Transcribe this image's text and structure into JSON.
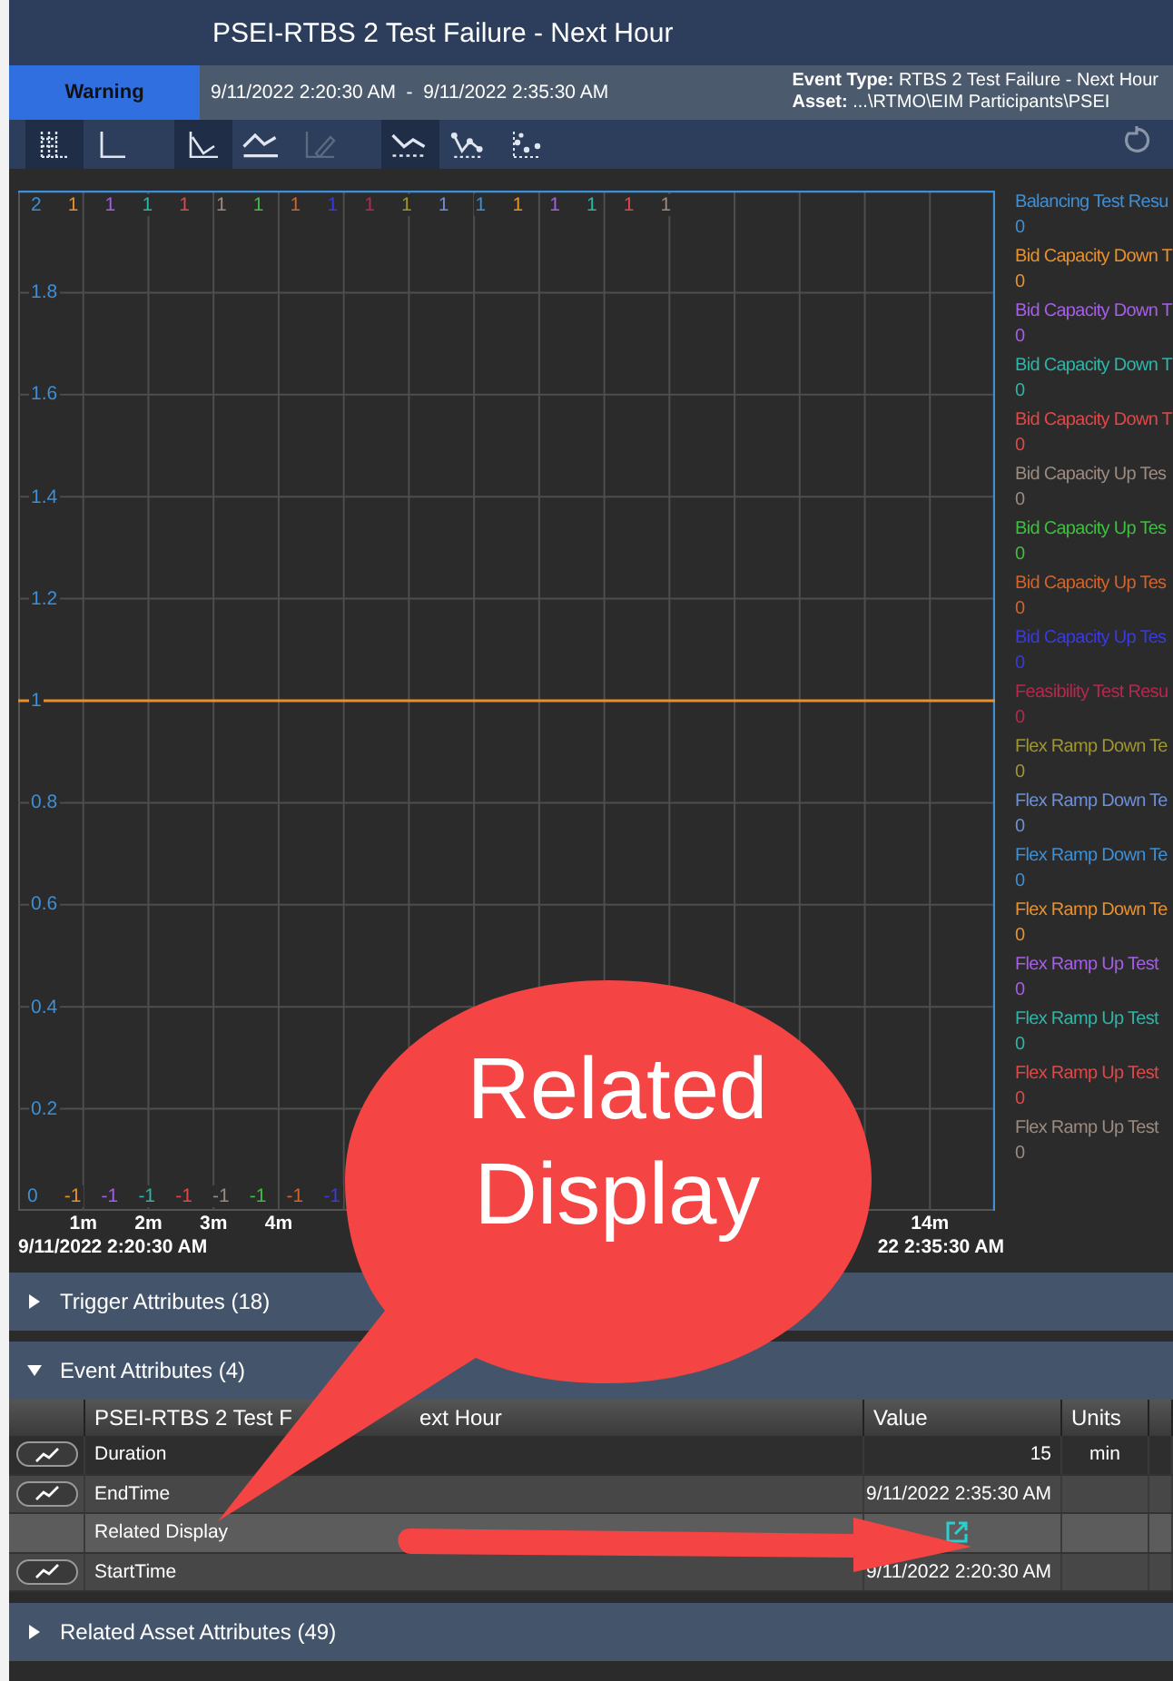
{
  "window": {
    "title": "PSEI-RTBS 2 Test Failure - Next Hour"
  },
  "event_bar": {
    "severity": "Warning",
    "time_range": "9/11/2022 2:20:30 AM  -  9/11/2022 2:35:30 AM",
    "event_type_label": "Event Type:",
    "event_type": "RTBS 2 Test Failure - Next Hour",
    "asset_label": "Asset:",
    "asset": "...\\RTMO\\EIM Participants\\PSEI"
  },
  "toolbar": [
    {
      "kind": "grid",
      "selected": true,
      "disabled": false
    },
    {
      "kind": "axes",
      "selected": false,
      "disabled": false
    },
    {
      "kind": "step",
      "selected": true,
      "disabled": false
    },
    {
      "kind": "line",
      "selected": false,
      "disabled": false
    },
    {
      "kind": "pencil",
      "selected": false,
      "disabled": true
    },
    {
      "kind": "dotted",
      "selected": true,
      "disabled": false
    },
    {
      "kind": "markers",
      "selected": false,
      "disabled": false
    },
    {
      "kind": "scatter",
      "selected": false,
      "disabled": false
    }
  ],
  "chart": {
    "chart_data": {
      "type": "line",
      "grid": true,
      "xlim": [
        0,
        15
      ],
      "ylim": [
        0,
        2
      ],
      "x": [
        0,
        15
      ],
      "series": [
        {
          "color": "#e8912c",
          "values": [
            1,
            1
          ]
        }
      ],
      "yticks": [
        {
          "value": 0.2,
          "label": "0.2"
        },
        {
          "value": 0.4,
          "label": "0.4"
        },
        {
          "value": 0.6,
          "label": "0.6"
        },
        {
          "value": 0.8,
          "label": "0.8"
        },
        {
          "value": 1,
          "label": "1"
        },
        {
          "value": 1.2,
          "label": "1.2"
        },
        {
          "value": 1.4,
          "label": "1.4"
        },
        {
          "value": 1.6,
          "label": "1.6"
        },
        {
          "value": 1.8,
          "label": "1.8"
        }
      ],
      "xticks": [
        {
          "value": 1,
          "label": "1m"
        },
        {
          "value": 2,
          "label": "2m"
        },
        {
          "value": 3,
          "label": "3m"
        },
        {
          "value": 4,
          "label": "4m"
        },
        {
          "value": 14,
          "label": "14m"
        }
      ]
    },
    "start_time": "9/11/2022 2:20:30 AM",
    "end_time": "22 2:35:30 AM",
    "legend": [
      {
        "name": "Balancing Test Resu",
        "value": "0",
        "color": "#3e8fd6",
        "max": "2",
        "min": "0"
      },
      {
        "name": "Bid Capacity Down T",
        "value": "0",
        "color": "#e8912c",
        "max": "1",
        "min": "-1"
      },
      {
        "name": "Bid Capacity Down T",
        "value": "0",
        "color": "#a65ee8",
        "max": "1",
        "min": "-1"
      },
      {
        "name": "Bid Capacity Down T",
        "value": "0",
        "color": "#2fb5a8",
        "max": "1",
        "min": "-1"
      },
      {
        "name": "Bid Capacity Down T",
        "value": "0",
        "color": "#e04848",
        "max": "1",
        "min": "-1"
      },
      {
        "name": "Bid Capacity Up Tes",
        "value": "0",
        "color": "#9b8b80",
        "max": "1",
        "min": "-1"
      },
      {
        "name": "Bid Capacity Up Tes",
        "value": "0",
        "color": "#3fbf3f",
        "max": "1",
        "min": "-1"
      },
      {
        "name": "Bid Capacity Up Tes",
        "value": "0",
        "color": "#d2642a",
        "max": "1",
        "min": "-1"
      },
      {
        "name": "Bid Capacity Up Tes",
        "value": "0",
        "color": "#3a3ae0",
        "max": "1",
        "min": "-1"
      },
      {
        "name": "Feasibility Test Resu",
        "value": "0",
        "color": "#b8284e",
        "max": "1"
      },
      {
        "name": "Flex Ramp Down Te",
        "value": "0",
        "color": "#a0962e",
        "max": "1"
      },
      {
        "name": "Flex Ramp Down Te",
        "value": "0",
        "color": "#6f8fd8",
        "max": "1"
      },
      {
        "name": "Flex Ramp Down Te",
        "value": "0",
        "color": "#3e8fd6",
        "max": "1"
      },
      {
        "name": "Flex Ramp Down Te",
        "value": "0",
        "color": "#e8912c",
        "max": "1"
      },
      {
        "name": "Flex Ramp Up Test",
        "value": "0",
        "color": "#a65ee8",
        "max": "1"
      },
      {
        "name": "Flex Ramp Up Test",
        "value": "0",
        "color": "#2fb5a8",
        "max": "1"
      },
      {
        "name": "Flex Ramp Up Test",
        "value": "0",
        "color": "#e04848",
        "max": "1"
      },
      {
        "name": "Flex Ramp Up Test",
        "value": "0",
        "color": "#9b8b80",
        "max": "1"
      }
    ]
  },
  "sections": [
    {
      "title": "Trigger Attributes (18)",
      "expanded": false
    },
    {
      "title": "Event Attributes (4)",
      "expanded": true
    },
    {
      "title": "Related Asset Attributes (49)",
      "expanded": false
    }
  ],
  "table": {
    "columns": [
      "PSEI-RTBS 2 Test F",
      "ext Hour",
      "Value",
      "Units"
    ],
    "rows": [
      {
        "kind": "value",
        "trend": true,
        "name": "Duration",
        "value": "15",
        "units": "min",
        "selected": false
      },
      {
        "kind": "value",
        "trend": true,
        "name": "EndTime",
        "value": "9/11/2022 2:35:30 AM",
        "selected": false
      },
      {
        "kind": "link",
        "trend": false,
        "name": "Related Display",
        "selected": true
      },
      {
        "kind": "value",
        "trend": true,
        "name": "StartTime",
        "value": "9/11/2022 2:20:30 AM",
        "selected": false
      }
    ]
  },
  "callout": {
    "text": "Related Display"
  }
}
